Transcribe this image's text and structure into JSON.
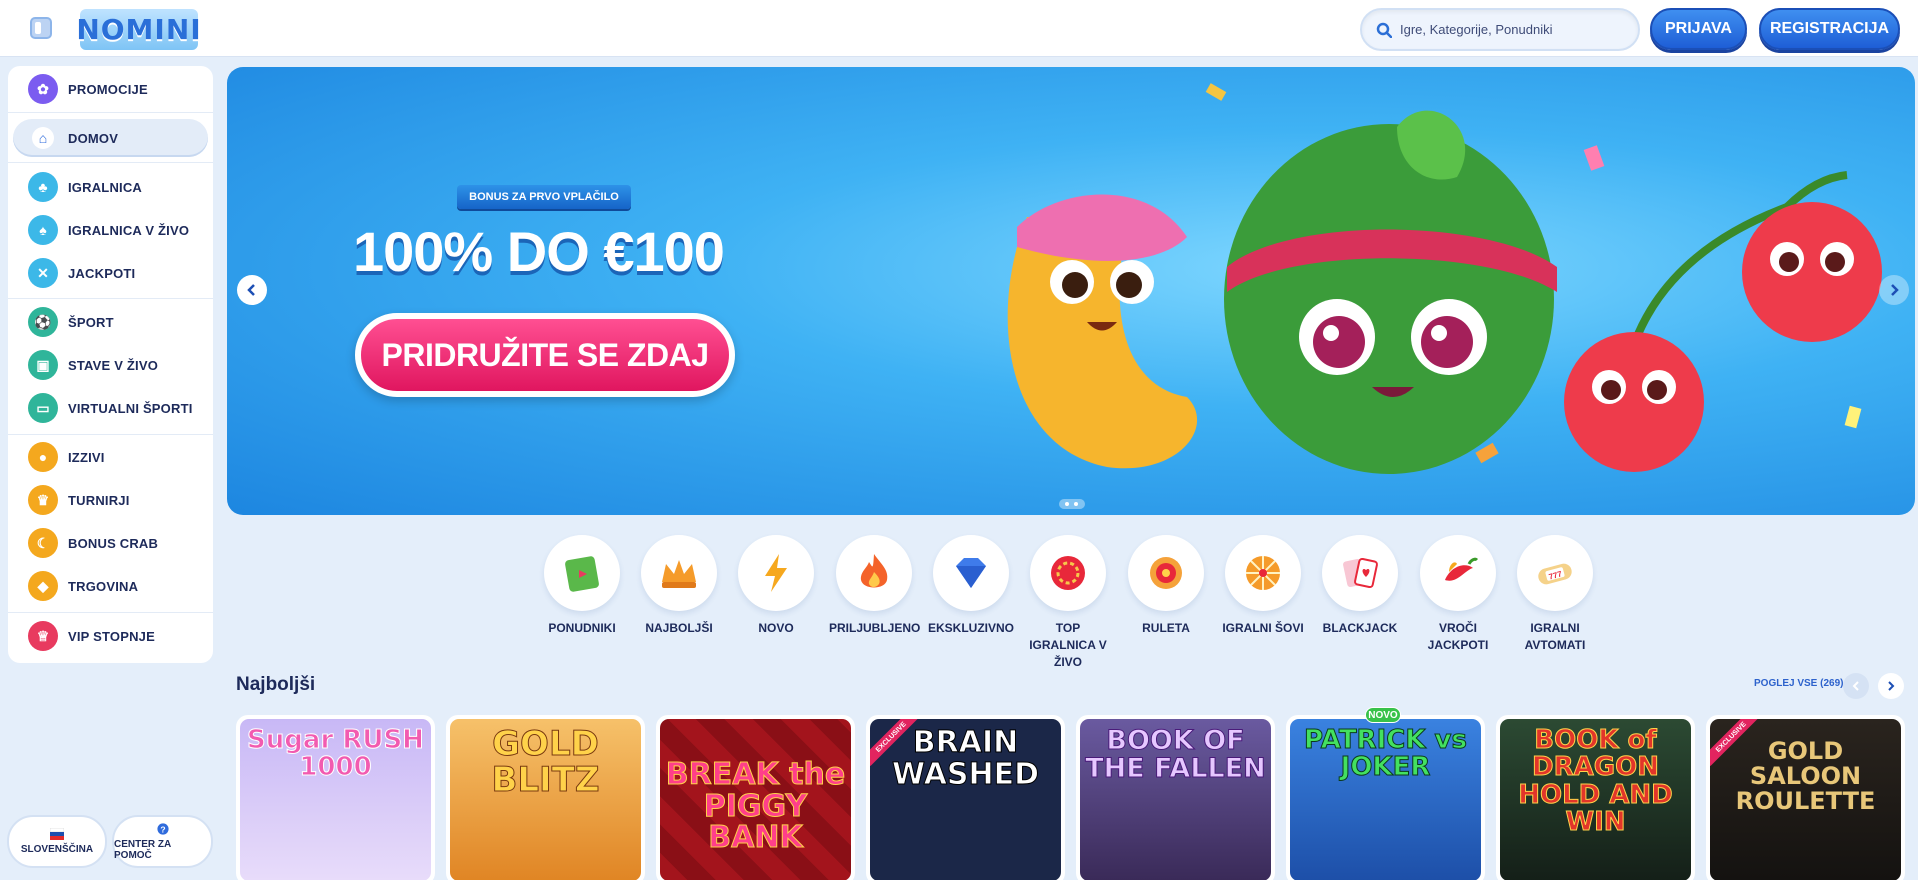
{
  "header": {
    "logo_text": "NOMINI",
    "search_placeholder": "Igre, Kategorije, Ponudniki",
    "login_label": "PRIJAVA",
    "register_label": "REGISTRACIJA"
  },
  "sidebar": {
    "items": [
      {
        "label": "PROMOCIJE",
        "icon": "gift-icon",
        "color": "#7b5cf0"
      },
      {
        "label": "DOMOV",
        "icon": "home-icon",
        "color": "#2f6bdc"
      },
      {
        "label": "IGRALNICA",
        "icon": "cherry-icon",
        "color": "#3cb8e8"
      },
      {
        "label": "IGRALNICA V ŽIVO",
        "icon": "cards-icon",
        "color": "#3cb8e8"
      },
      {
        "label": "JACKPOTI",
        "icon": "chip-icon",
        "color": "#3cb8e8"
      },
      {
        "label": "ŠPORT",
        "icon": "ball-icon",
        "color": "#2fb59a"
      },
      {
        "label": "STAVE V ŽIVO",
        "icon": "live-icon",
        "color": "#2fb59a"
      },
      {
        "label": "VIRTUALNI ŠPORTI",
        "icon": "screen-icon",
        "color": "#2fb59a"
      },
      {
        "label": "IZZIVI",
        "icon": "medal-icon",
        "color": "#f4a81e"
      },
      {
        "label": "TURNIRJI",
        "icon": "trophy-icon",
        "color": "#f4a81e"
      },
      {
        "label": "BONUS CRAB",
        "icon": "crab-icon",
        "color": "#f4a81e"
      },
      {
        "label": "TRGOVINA",
        "icon": "shop-icon",
        "color": "#f4a81e"
      },
      {
        "label": "VIP STOPNJE",
        "icon": "crown-icon",
        "color": "#e83a5f"
      }
    ],
    "language_label": "SLOVENŠČINA",
    "help_label": "CENTER ZA POMOČ"
  },
  "hero": {
    "ribbon": "BONUS ZA PRVO VPLAČILO",
    "title": "100% DO €100",
    "cta": "PRIDRUŽITE SE ZDAJ"
  },
  "categories": [
    {
      "label": "PONUDNIKI",
      "icon": "book-icon"
    },
    {
      "label": "NAJBOLJŠI",
      "icon": "crown-icon"
    },
    {
      "label": "NOVO",
      "icon": "lightning-icon"
    },
    {
      "label": "PRILJUBLJENO",
      "icon": "flame-icon"
    },
    {
      "label": "EKSKLUZIVNO",
      "icon": "diamond-icon"
    },
    {
      "label": "TOP IGRALNICA V ŽIVO",
      "icon": "chip-icon"
    },
    {
      "label": "RULETA",
      "icon": "roulette-icon"
    },
    {
      "label": "IGRALNI ŠOVI",
      "icon": "wheel-icon"
    },
    {
      "label": "BLACKJACK",
      "icon": "cards-icon"
    },
    {
      "label": "VROČI JACKPOTI",
      "icon": "pepper-icon"
    },
    {
      "label": "IGRALNI AVTOMATI",
      "icon": "slot-icon"
    }
  ],
  "section": {
    "title": "Najboljši",
    "view_all": "POGLEJ VSE (269)"
  },
  "games": [
    {
      "title": "Sugar RUSH 1000",
      "bg": "#b9a7f0",
      "color": "#f25bb0",
      "badge": ""
    },
    {
      "title": "GOLD BLITZ",
      "bg": "#f3a43a",
      "color": "#ffd24a",
      "badge": ""
    },
    {
      "title": "BREAK the PIGGY BANK",
      "bg": "#9a1218",
      "color": "#ff3f8a",
      "badge": ""
    },
    {
      "title": "BRAIN WASHED",
      "bg": "#1b2748",
      "color": "#ffffff",
      "badge": "EXCLUSIVE"
    },
    {
      "title": "BOOK OF THE FALLEN",
      "bg": "#4a3a72",
      "color": "#e6c7ff",
      "badge": ""
    },
    {
      "title": "PATRICK vs JOKER",
      "bg": "#2b67c9",
      "color": "#43e060",
      "badge": "NOVO"
    },
    {
      "title": "BOOK of DRAGON HOLD AND WIN",
      "bg": "#2c4a33",
      "color": "#e2352a",
      "badge": ""
    },
    {
      "title": "GOLD SALOON ROULETTE",
      "bg": "#1f1b17",
      "color": "#e8c779",
      "badge": "EXCLUSIVE"
    }
  ]
}
